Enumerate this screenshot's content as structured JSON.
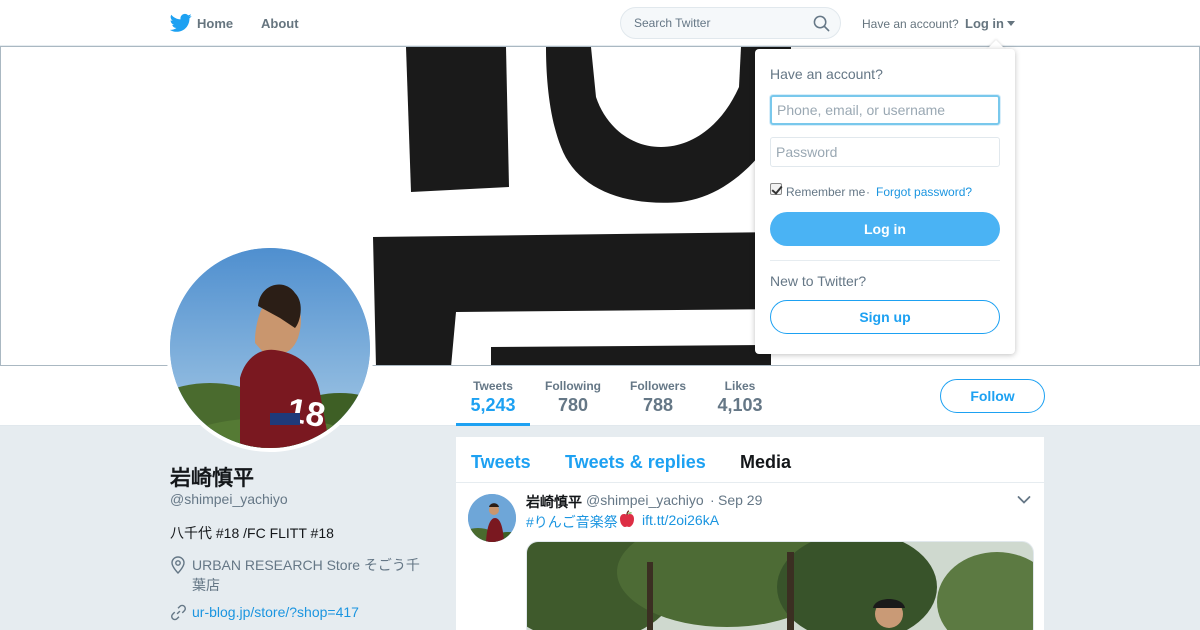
{
  "nav": {
    "home_label": "Home",
    "about_label": "About",
    "search_placeholder": "Search Twitter",
    "have_account_text": "Have an account?",
    "login_label": "Log in"
  },
  "profile_nav": {
    "stats": [
      {
        "label": "Tweets",
        "value": "5,243"
      },
      {
        "label": "Following",
        "value": "780"
      },
      {
        "label": "Followers",
        "value": "788"
      },
      {
        "label": "Likes",
        "value": "4,103"
      }
    ],
    "follow_label": "Follow"
  },
  "profile": {
    "name": "岩崎慎平",
    "handle": "@shimpei_yachiyo",
    "bio": "八千代 #18 /FC FLITT #18",
    "location": "URBAN RESEARCH Store そごう千葉店",
    "url": "ur-blog.jp/store/?shop=417"
  },
  "timeline": {
    "tabs": [
      "Tweets",
      "Tweets & replies",
      "Media"
    ],
    "tweet": {
      "name": "岩崎慎平",
      "handle": "@shimpei_yachiyo",
      "separator": "·",
      "date": "Sep 29",
      "hashtag": "#りんご音楽祭",
      "emoji": "red-apple-icon",
      "link": "ift.tt/2oi26kA"
    }
  },
  "login_dropdown": {
    "title": "Have an account?",
    "username_placeholder": "Phone, email, or username",
    "password_placeholder": "Password",
    "remember_label": "Remember me",
    "separator": "·",
    "forgot_label": "Forgot password?",
    "login_button": "Log in",
    "new_text": "New to Twitter?",
    "signup_button": "Sign up"
  },
  "colors": {
    "accent": "#1da1f2",
    "link": "#1b95e0",
    "login_button_bg": "#4ab3f4",
    "page_bg": "#e6ecf0"
  }
}
